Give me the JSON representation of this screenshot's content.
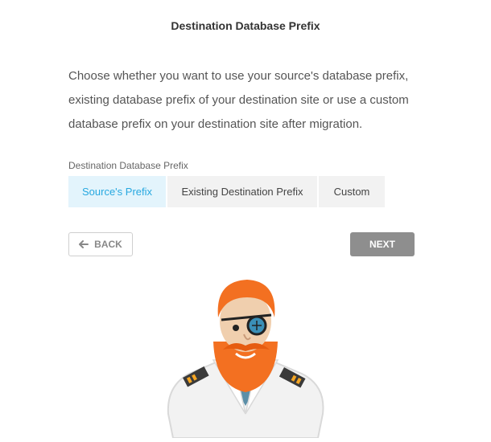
{
  "header": {
    "title": "Destination Database Prefix"
  },
  "description": "Choose whether you want to use your source's database prefix, existing database prefix of your destination site or use a custom database prefix on your destination site after migration.",
  "prefix_selector": {
    "label": "Destination Database Prefix",
    "options": [
      {
        "label": "Source's Prefix",
        "selected": true
      },
      {
        "label": "Existing Destination Prefix",
        "selected": false
      },
      {
        "label": "Custom",
        "selected": false
      }
    ]
  },
  "footer": {
    "back_label": "BACK",
    "next_label": "NEXT",
    "back_icon": "arrow-left-icon"
  },
  "colors": {
    "accent": "#27a8e0",
    "active_bg": "#e3f4fc",
    "next_bg": "#8e8e8e",
    "mascot_hair": "#f37021"
  }
}
